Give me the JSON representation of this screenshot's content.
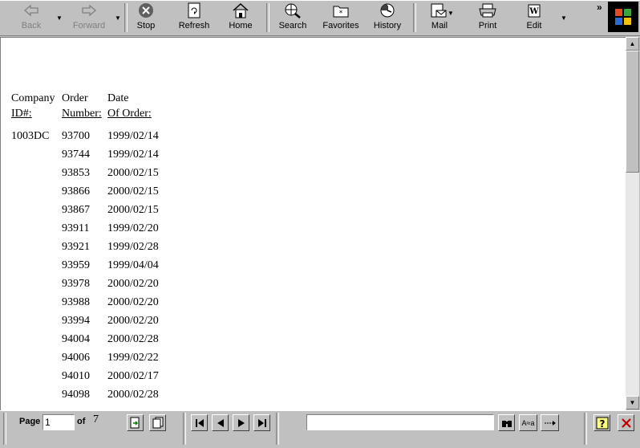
{
  "toolbar": {
    "back": "Back",
    "forward": "Forward",
    "stop": "Stop",
    "refresh": "Refresh",
    "home": "Home",
    "search": "Search",
    "favorites": "Favorites",
    "history": "History",
    "mail": "Mail",
    "print": "Print",
    "edit": "Edit",
    "more": "»"
  },
  "report": {
    "headers": {
      "company_line1": "Company",
      "company_line2": "ID#:",
      "order_line1": "Order",
      "order_line2": "Number:",
      "date_line1": "Date",
      "date_line2": "Of Order:"
    },
    "rows": [
      {
        "company": "1003DC",
        "order": "93700",
        "date": "1999/02/14"
      },
      {
        "company": "",
        "order": "93744",
        "date": "1999/02/14"
      },
      {
        "company": "",
        "order": "93853",
        "date": "2000/02/15"
      },
      {
        "company": "",
        "order": "93866",
        "date": "2000/02/15"
      },
      {
        "company": "",
        "order": "93867",
        "date": "2000/02/15"
      },
      {
        "company": "",
        "order": "93911",
        "date": "1999/02/20"
      },
      {
        "company": "",
        "order": "93921",
        "date": "1999/02/28"
      },
      {
        "company": "",
        "order": "93959",
        "date": "1999/04/04"
      },
      {
        "company": "",
        "order": "93978",
        "date": "2000/02/20"
      },
      {
        "company": "",
        "order": "93988",
        "date": "2000/02/20"
      },
      {
        "company": "",
        "order": "93994",
        "date": "2000/02/20"
      },
      {
        "company": "",
        "order": "94004",
        "date": "2000/02/28"
      },
      {
        "company": "",
        "order": "94006",
        "date": "1999/02/22"
      },
      {
        "company": "",
        "order": "94010",
        "date": "2000/02/17"
      },
      {
        "company": "",
        "order": "94098",
        "date": "2000/02/28"
      }
    ]
  },
  "viewer": {
    "page_label": "Page",
    "page_value": "1",
    "of_label": "of",
    "total_pages": "7",
    "search_value": ""
  },
  "colors": {
    "chrome": "#c0c0c0",
    "content_bg": "#ffffff"
  }
}
